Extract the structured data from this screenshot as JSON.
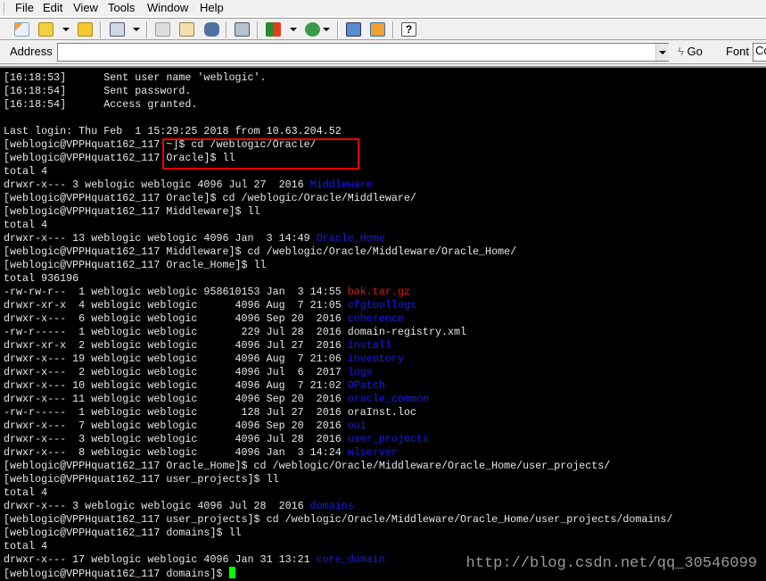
{
  "menu": [
    "File",
    "Edit",
    "View",
    "Tools",
    "Window",
    "Help"
  ],
  "toolbar": {
    "icons": [
      "new-session-icon",
      "open-folder-icon",
      "reconnect-icon",
      "session-options-icon",
      "copy-icon",
      "paste-icon",
      "find-icon",
      "print-icon",
      "color-scheme-icon",
      "globe-icon",
      "key-manager-icon",
      "sftp-icon",
      "help-icon"
    ]
  },
  "address": {
    "label": "Address",
    "value": "",
    "go": "Go",
    "font_label": "Font",
    "font_value": "Co"
  },
  "terminal": {
    "lines": [
      [
        [
          "[16:18:53]      Sent user name 'weblogic'.",
          ""
        ]
      ],
      [
        [
          "[16:18:54]      Sent password.",
          ""
        ]
      ],
      [
        [
          "[16:18:54]      Access granted.",
          ""
        ]
      ],
      [
        [
          "",
          ""
        ]
      ],
      [
        [
          "Last login: Thu Feb  1 15:29:25 2018 from 10.63.204.52",
          ""
        ]
      ],
      [
        [
          "[weblogic@VPPHquat162_117 ~]$ cd /weblogic/Oracle/",
          ""
        ]
      ],
      [
        [
          "[weblogic@VPPHquat162_117 Oracle]$ ll",
          ""
        ]
      ],
      [
        [
          "total 4",
          ""
        ]
      ],
      [
        [
          "drwxr-x--- 3 weblogic weblogic 4096 Jul 27  2016 ",
          ""
        ],
        [
          "Middleware",
          "blue"
        ]
      ],
      [
        [
          "[weblogic@VPPHquat162_117 Oracle]$ cd /weblogic/Oracle/Middleware/",
          ""
        ]
      ],
      [
        [
          "[weblogic@VPPHquat162_117 Middleware]$ ll",
          ""
        ]
      ],
      [
        [
          "total 4",
          ""
        ]
      ],
      [
        [
          "drwxr-x--- 13 weblogic weblogic 4096 Jan  3 14:49 ",
          ""
        ],
        [
          "Oracle_Home",
          "blue"
        ]
      ],
      [
        [
          "[weblogic@VPPHquat162_117 Middleware]$ cd /weblogic/Oracle/Middleware/Oracle_Home/",
          ""
        ]
      ],
      [
        [
          "[weblogic@VPPHquat162_117 Oracle_Home]$ ll",
          ""
        ]
      ],
      [
        [
          "total 936196",
          ""
        ]
      ],
      [
        [
          "-rw-rw-r--  1 weblogic weblogic 958610153 Jan  3 14:55 ",
          ""
        ],
        [
          "bak.tar.gz",
          "red"
        ]
      ],
      [
        [
          "drwxr-xr-x  4 weblogic weblogic      4096 Aug  7 21:05 ",
          ""
        ],
        [
          "cfgtoollogs",
          "blue"
        ]
      ],
      [
        [
          "drwxr-x---  6 weblogic weblogic      4096 Sep 20  2016 ",
          ""
        ],
        [
          "coherence",
          "blue"
        ]
      ],
      [
        [
          "-rw-r-----  1 weblogic weblogic       229 Jul 28  2016 domain-registry.xml",
          ""
        ]
      ],
      [
        [
          "drwxr-xr-x  2 weblogic weblogic      4096 Jul 27  2016 ",
          ""
        ],
        [
          "install",
          "blue"
        ]
      ],
      [
        [
          "drwxr-x--- 19 weblogic weblogic      4096 Aug  7 21:06 ",
          ""
        ],
        [
          "inventory",
          "blue"
        ]
      ],
      [
        [
          "drwxr-x---  2 weblogic weblogic      4096 Jul  6  2017 ",
          ""
        ],
        [
          "logs",
          "blue"
        ]
      ],
      [
        [
          "drwxr-x--- 10 weblogic weblogic      4096 Aug  7 21:02 ",
          ""
        ],
        [
          "OPatch",
          "blue"
        ]
      ],
      [
        [
          "drwxr-x--- 11 weblogic weblogic      4096 Sep 20  2016 ",
          ""
        ],
        [
          "oracle_common",
          "blue"
        ]
      ],
      [
        [
          "-rw-r-----  1 weblogic weblogic       128 Jul 27  2016 oraInst.loc",
          ""
        ]
      ],
      [
        [
          "drwxr-x---  7 weblogic weblogic      4096 Sep 20  2016 ",
          ""
        ],
        [
          "oui",
          "blue"
        ]
      ],
      [
        [
          "drwxr-x---  3 weblogic weblogic      4096 Jul 28  2016 ",
          ""
        ],
        [
          "user_projects",
          "blue"
        ]
      ],
      [
        [
          "drwxr-x---  8 weblogic weblogic      4096 Jan  3 14:24 ",
          ""
        ],
        [
          "wlserver",
          "blue"
        ]
      ],
      [
        [
          "[weblogic@VPPHquat162_117 Oracle_Home]$ cd /weblogic/Oracle/Middleware/Oracle_Home/user_projects/",
          ""
        ]
      ],
      [
        [
          "[weblogic@VPPHquat162_117 user_projects]$ ll",
          ""
        ]
      ],
      [
        [
          "total 4",
          ""
        ]
      ],
      [
        [
          "drwxr-x--- 3 weblogic weblogic 4096 Jul 28  2016 ",
          ""
        ],
        [
          "domains",
          "blue"
        ]
      ],
      [
        [
          "[weblogic@VPPHquat162_117 user_projects]$ cd /weblogic/Oracle/Middleware/Oracle_Home/user_projects/domains/",
          ""
        ]
      ],
      [
        [
          "[weblogic@VPPHquat162_117 domains]$ ll",
          ""
        ]
      ],
      [
        [
          "total 4",
          ""
        ]
      ],
      [
        [
          "drwxr-x--- 17 weblogic weblogic 4096 Jan 31 13:21 ",
          ""
        ],
        [
          "core_domain",
          "blue"
        ]
      ],
      [
        [
          "[weblogic@VPPHquat162_117 domains]$ ",
          ""
        ]
      ]
    ]
  },
  "watermark": "http://blog.csdn.net/qq_30546099",
  "colors": {
    "highlight": "#ee0000",
    "dir": "#1a1aee",
    "archive": "#ee1111",
    "cursor": "#00ff00"
  }
}
